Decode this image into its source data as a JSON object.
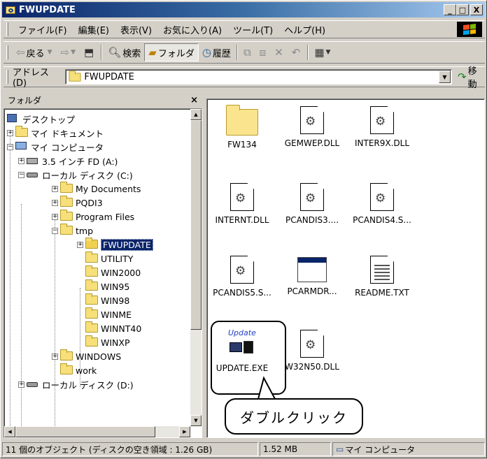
{
  "window": {
    "title": "FWUPDATE",
    "controls": {
      "minimize": "_",
      "maximize": "□",
      "close": "X"
    }
  },
  "menu": [
    "ファイル(F)",
    "編集(E)",
    "表示(V)",
    "お気に入り(A)",
    "ツール(T)",
    "ヘルプ(H)"
  ],
  "toolbar": {
    "back": "戻る",
    "search": "検索",
    "folders": "フォルダ",
    "history": "履歴"
  },
  "address": {
    "label": "アドレス(D)",
    "value": "FWUPDATE",
    "go": "移動"
  },
  "folder_pane": {
    "title": "フォルダ",
    "close": "×",
    "tree": [
      {
        "label": "デスクトップ"
      },
      {
        "label": "マイ ドキュメント"
      },
      {
        "label": "マイ コンピュータ"
      },
      {
        "label": "3.5 インチ FD (A:)"
      },
      {
        "label": "ローカル ディスク (C:)"
      },
      {
        "label": "My Documents"
      },
      {
        "label": "PQDI3"
      },
      {
        "label": "Program Files"
      },
      {
        "label": "tmp"
      },
      {
        "label": "FWUPDATE"
      },
      {
        "label": "UTILITY"
      },
      {
        "label": "WIN2000"
      },
      {
        "label": "WIN95"
      },
      {
        "label": "WIN98"
      },
      {
        "label": "WINME"
      },
      {
        "label": "WINNT40"
      },
      {
        "label": "WINXP"
      },
      {
        "label": "WINDOWS"
      },
      {
        "label": "work"
      },
      {
        "label": "ローカル ディスク (D:)"
      }
    ]
  },
  "files": [
    {
      "name": "FW134",
      "icon": "folder-icon"
    },
    {
      "name": "GEMWEP.DLL",
      "icon": "dll-icon"
    },
    {
      "name": "INTER9X.DLL",
      "icon": "dll-icon"
    },
    {
      "name": "INTERNT.DLL",
      "icon": "dll-icon"
    },
    {
      "name": "PCANDIS3....",
      "icon": "dll-icon"
    },
    {
      "name": "PCANDIS4.S...",
      "icon": "dll-icon"
    },
    {
      "name": "PCANDIS5.S...",
      "icon": "dll-icon"
    },
    {
      "name": "PCARMDR...",
      "icon": "window-app-icon"
    },
    {
      "name": "README.TXT",
      "icon": "text-doc-icon"
    },
    {
      "name": "UPDATE.EXE",
      "icon": "update-app-icon",
      "icon_text": "Update"
    },
    {
      "name": "W32N50.DLL",
      "icon": "dll-icon"
    }
  ],
  "annotation": {
    "callout_text": "ダブルクリック"
  },
  "status": {
    "objects": "11 個のオブジェクト (ディスクの空き領域 : 1.26 GB)",
    "size": "1.52 MB",
    "location": "マイ コンピュータ"
  }
}
